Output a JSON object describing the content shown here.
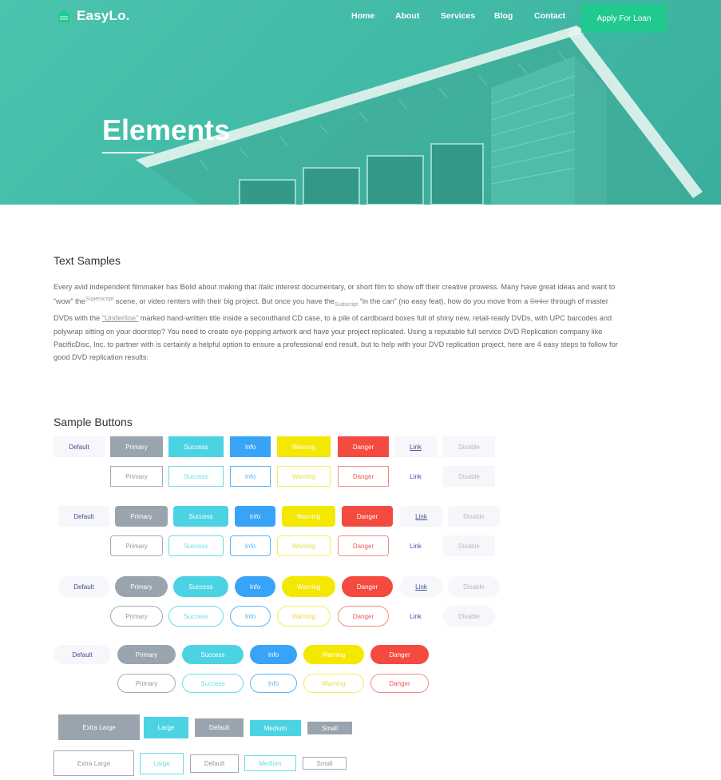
{
  "nav": {
    "logo": "EasyLo.",
    "items": [
      "Home",
      "About",
      "Services",
      "Blog",
      "Contact"
    ],
    "cta": "Apply For Loan"
  },
  "hero": {
    "title": "Elements"
  },
  "text_samples": {
    "title": "Text Samples",
    "p1": "Every avid independent filmmaker has ",
    "bold": "Bold",
    "p2": " about making that ",
    "italic": "Italic",
    "p3": " interest documentary, or short film to show off their creative prowess. Many have great ideas and want to “wow” the",
    "superscript": "Superscript",
    "p4": " scene, or video renters with their big project. But once you have the",
    "subscript": "Subscript",
    "p5": " “in the can” (no easy feat), how do you move from a ",
    "strike": "Strike",
    "p6": " through of master DVDs with the ",
    "underline": "“Underline”",
    "p7": " marked hand-written title inside a secondhand CD case, to a pile of cardboard boxes full of shiny new, retail-ready DVDs, with UPC barcodes and polywrap sitting on your doorstep? You need to create eye-popping artwork and have your project replicated. Using a reputable full service DVD Replication company like PacificDisc, Inc. to partner with is certainly a helpful option to ensure a professional end result, but to help with your DVD replication project, here are 4 easy steps to follow for good DVD replication results:"
  },
  "buttons": {
    "title": "Sample Buttons",
    "labels": {
      "default": "Default",
      "primary": "Primary",
      "success": "Success",
      "info": "Info",
      "warning": "Warning",
      "danger": "Danger",
      "link": "Link",
      "disable": "Disable"
    },
    "sizes": [
      "Extra Large",
      "Large",
      "Default",
      "Medium",
      "Small"
    ]
  },
  "colors": {
    "hero": "#45bfa9",
    "accent": "#22c98f",
    "primary": "#9aa4ae",
    "success": "#4cd3e3",
    "info": "#38a4f8",
    "warning": "#f4e700",
    "danger": "#f44a40",
    "default_bg": "#f6f6fb",
    "default_text": "#415094"
  }
}
